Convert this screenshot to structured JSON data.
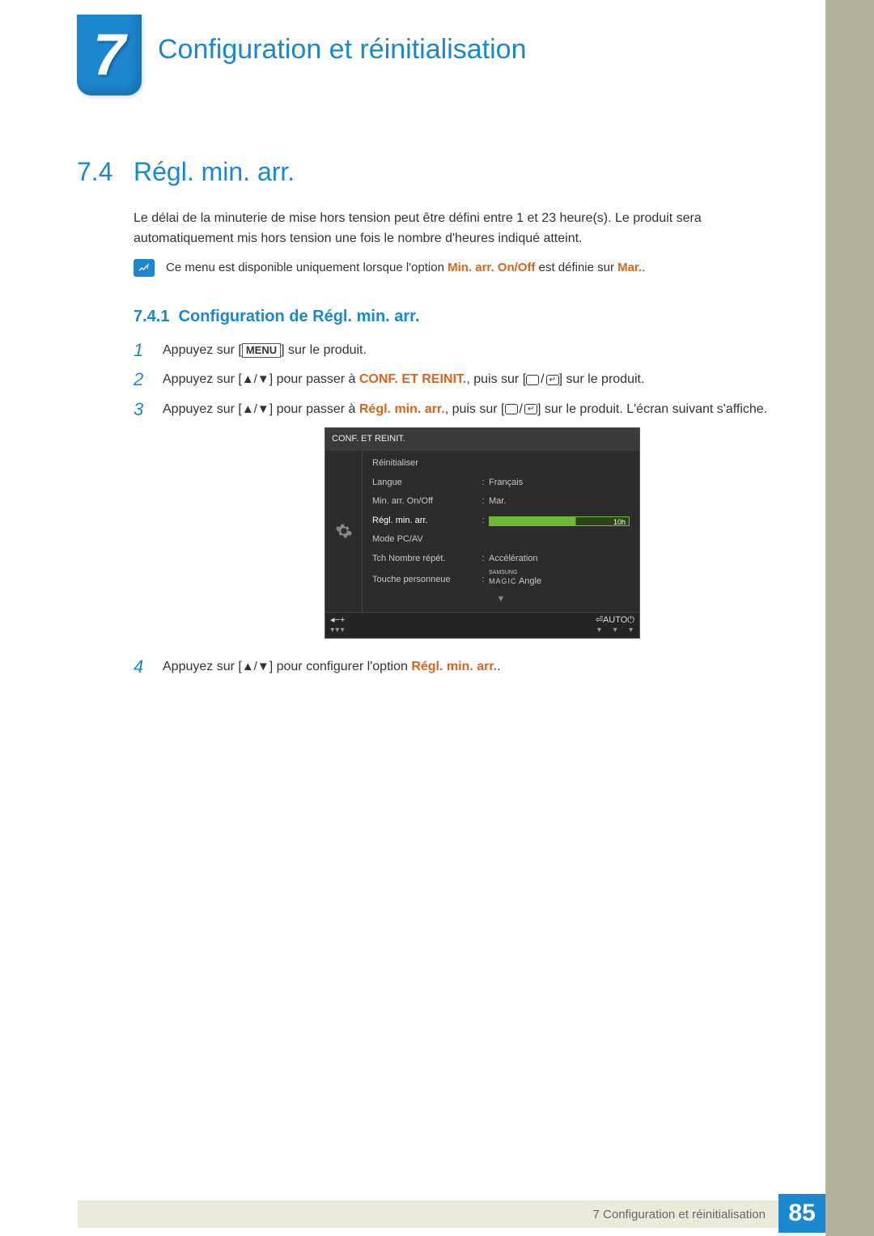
{
  "chapter": {
    "number": "7",
    "title": "Configuration et réinitialisation"
  },
  "section": {
    "number": "7.4",
    "title": "Régl. min. arr."
  },
  "body_intro": "Le délai de la minuterie de mise hors tension peut être défini entre 1 et 23 heure(s). Le produit sera automatiquement mis hors tension une fois le nombre d'heures indiqué atteint.",
  "note": {
    "pre": "Ce menu est disponible uniquement lorsque l'option ",
    "hl1": "Min. arr. On/Off",
    "mid": " est définie sur ",
    "hl2": "Mar.",
    "post": "."
  },
  "subsection": {
    "number": "7.4.1",
    "title": "Configuration de Régl. min. arr."
  },
  "steps": {
    "s1": {
      "num": "1",
      "pre": "Appuyez sur [",
      "menu": "MENU",
      "post": "] sur le produit."
    },
    "s2": {
      "num": "2",
      "pre": "Appuyez sur [",
      "arrows": "▲/▼",
      "mid1": "] pour passer à ",
      "hl": "CONF. ET REINIT.",
      "mid2": ", puis sur [",
      "post": "] sur le produit."
    },
    "s3": {
      "num": "3",
      "pre": "Appuyez sur [",
      "arrows": "▲/▼",
      "mid1": "] pour passer à ",
      "hl": "Régl. min. arr.",
      "mid2": ", puis sur [",
      "post": "] sur le produit. L'écran suivant s'affiche."
    },
    "s4": {
      "num": "4",
      "pre": "Appuyez sur [",
      "arrows": "▲/▼",
      "mid": "] pour configurer l'option ",
      "hl": "Régl. min. arr.",
      "post": "."
    }
  },
  "osd": {
    "title": "CONF. ET REINIT.",
    "rows": [
      {
        "label": "Réinitialiser",
        "value": ""
      },
      {
        "label": "Langue",
        "value": "Français"
      },
      {
        "label": "Min. arr. On/Off",
        "value": "Mar."
      },
      {
        "label": "Régl. min. arr.",
        "value": "10h",
        "active": true,
        "bar": true
      },
      {
        "label": "Mode PC/AV",
        "value": ""
      },
      {
        "label": "Tch Nombre répét.",
        "value": "Accélération"
      },
      {
        "label": "Touche personneue",
        "value": "Angle",
        "magic": true
      }
    ],
    "footer_auto": "AUTO"
  },
  "footer": {
    "text": "7 Configuration et réinitialisation",
    "page": "85"
  }
}
